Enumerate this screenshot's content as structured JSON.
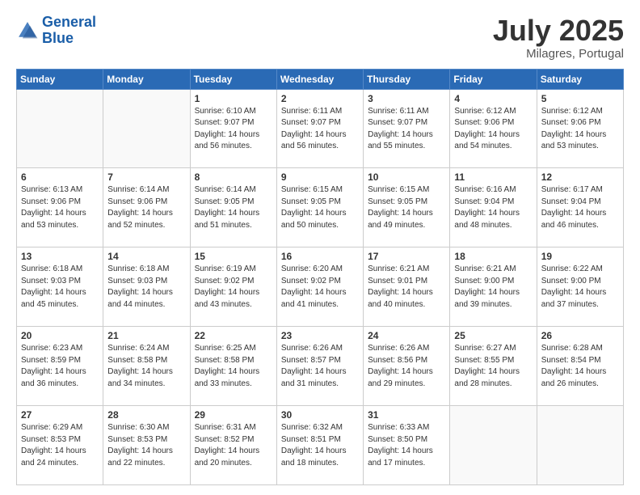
{
  "logo": {
    "line1": "General",
    "line2": "Blue"
  },
  "header": {
    "month": "July 2025",
    "location": "Milagres, Portugal"
  },
  "weekdays": [
    "Sunday",
    "Monday",
    "Tuesday",
    "Wednesday",
    "Thursday",
    "Friday",
    "Saturday"
  ],
  "weeks": [
    [
      {
        "day": "",
        "sunrise": "",
        "sunset": "",
        "daylight": ""
      },
      {
        "day": "",
        "sunrise": "",
        "sunset": "",
        "daylight": ""
      },
      {
        "day": "1",
        "sunrise": "Sunrise: 6:10 AM",
        "sunset": "Sunset: 9:07 PM",
        "daylight": "Daylight: 14 hours and 56 minutes."
      },
      {
        "day": "2",
        "sunrise": "Sunrise: 6:11 AM",
        "sunset": "Sunset: 9:07 PM",
        "daylight": "Daylight: 14 hours and 56 minutes."
      },
      {
        "day": "3",
        "sunrise": "Sunrise: 6:11 AM",
        "sunset": "Sunset: 9:07 PM",
        "daylight": "Daylight: 14 hours and 55 minutes."
      },
      {
        "day": "4",
        "sunrise": "Sunrise: 6:12 AM",
        "sunset": "Sunset: 9:06 PM",
        "daylight": "Daylight: 14 hours and 54 minutes."
      },
      {
        "day": "5",
        "sunrise": "Sunrise: 6:12 AM",
        "sunset": "Sunset: 9:06 PM",
        "daylight": "Daylight: 14 hours and 53 minutes."
      }
    ],
    [
      {
        "day": "6",
        "sunrise": "Sunrise: 6:13 AM",
        "sunset": "Sunset: 9:06 PM",
        "daylight": "Daylight: 14 hours and 53 minutes."
      },
      {
        "day": "7",
        "sunrise": "Sunrise: 6:14 AM",
        "sunset": "Sunset: 9:06 PM",
        "daylight": "Daylight: 14 hours and 52 minutes."
      },
      {
        "day": "8",
        "sunrise": "Sunrise: 6:14 AM",
        "sunset": "Sunset: 9:05 PM",
        "daylight": "Daylight: 14 hours and 51 minutes."
      },
      {
        "day": "9",
        "sunrise": "Sunrise: 6:15 AM",
        "sunset": "Sunset: 9:05 PM",
        "daylight": "Daylight: 14 hours and 50 minutes."
      },
      {
        "day": "10",
        "sunrise": "Sunrise: 6:15 AM",
        "sunset": "Sunset: 9:05 PM",
        "daylight": "Daylight: 14 hours and 49 minutes."
      },
      {
        "day": "11",
        "sunrise": "Sunrise: 6:16 AM",
        "sunset": "Sunset: 9:04 PM",
        "daylight": "Daylight: 14 hours and 48 minutes."
      },
      {
        "day": "12",
        "sunrise": "Sunrise: 6:17 AM",
        "sunset": "Sunset: 9:04 PM",
        "daylight": "Daylight: 14 hours and 46 minutes."
      }
    ],
    [
      {
        "day": "13",
        "sunrise": "Sunrise: 6:18 AM",
        "sunset": "Sunset: 9:03 PM",
        "daylight": "Daylight: 14 hours and 45 minutes."
      },
      {
        "day": "14",
        "sunrise": "Sunrise: 6:18 AM",
        "sunset": "Sunset: 9:03 PM",
        "daylight": "Daylight: 14 hours and 44 minutes."
      },
      {
        "day": "15",
        "sunrise": "Sunrise: 6:19 AM",
        "sunset": "Sunset: 9:02 PM",
        "daylight": "Daylight: 14 hours and 43 minutes."
      },
      {
        "day": "16",
        "sunrise": "Sunrise: 6:20 AM",
        "sunset": "Sunset: 9:02 PM",
        "daylight": "Daylight: 14 hours and 41 minutes."
      },
      {
        "day": "17",
        "sunrise": "Sunrise: 6:21 AM",
        "sunset": "Sunset: 9:01 PM",
        "daylight": "Daylight: 14 hours and 40 minutes."
      },
      {
        "day": "18",
        "sunrise": "Sunrise: 6:21 AM",
        "sunset": "Sunset: 9:00 PM",
        "daylight": "Daylight: 14 hours and 39 minutes."
      },
      {
        "day": "19",
        "sunrise": "Sunrise: 6:22 AM",
        "sunset": "Sunset: 9:00 PM",
        "daylight": "Daylight: 14 hours and 37 minutes."
      }
    ],
    [
      {
        "day": "20",
        "sunrise": "Sunrise: 6:23 AM",
        "sunset": "Sunset: 8:59 PM",
        "daylight": "Daylight: 14 hours and 36 minutes."
      },
      {
        "day": "21",
        "sunrise": "Sunrise: 6:24 AM",
        "sunset": "Sunset: 8:58 PM",
        "daylight": "Daylight: 14 hours and 34 minutes."
      },
      {
        "day": "22",
        "sunrise": "Sunrise: 6:25 AM",
        "sunset": "Sunset: 8:58 PM",
        "daylight": "Daylight: 14 hours and 33 minutes."
      },
      {
        "day": "23",
        "sunrise": "Sunrise: 6:26 AM",
        "sunset": "Sunset: 8:57 PM",
        "daylight": "Daylight: 14 hours and 31 minutes."
      },
      {
        "day": "24",
        "sunrise": "Sunrise: 6:26 AM",
        "sunset": "Sunset: 8:56 PM",
        "daylight": "Daylight: 14 hours and 29 minutes."
      },
      {
        "day": "25",
        "sunrise": "Sunrise: 6:27 AM",
        "sunset": "Sunset: 8:55 PM",
        "daylight": "Daylight: 14 hours and 28 minutes."
      },
      {
        "day": "26",
        "sunrise": "Sunrise: 6:28 AM",
        "sunset": "Sunset: 8:54 PM",
        "daylight": "Daylight: 14 hours and 26 minutes."
      }
    ],
    [
      {
        "day": "27",
        "sunrise": "Sunrise: 6:29 AM",
        "sunset": "Sunset: 8:53 PM",
        "daylight": "Daylight: 14 hours and 24 minutes."
      },
      {
        "day": "28",
        "sunrise": "Sunrise: 6:30 AM",
        "sunset": "Sunset: 8:53 PM",
        "daylight": "Daylight: 14 hours and 22 minutes."
      },
      {
        "day": "29",
        "sunrise": "Sunrise: 6:31 AM",
        "sunset": "Sunset: 8:52 PM",
        "daylight": "Daylight: 14 hours and 20 minutes."
      },
      {
        "day": "30",
        "sunrise": "Sunrise: 6:32 AM",
        "sunset": "Sunset: 8:51 PM",
        "daylight": "Daylight: 14 hours and 18 minutes."
      },
      {
        "day": "31",
        "sunrise": "Sunrise: 6:33 AM",
        "sunset": "Sunset: 8:50 PM",
        "daylight": "Daylight: 14 hours and 17 minutes."
      },
      {
        "day": "",
        "sunrise": "",
        "sunset": "",
        "daylight": ""
      },
      {
        "day": "",
        "sunrise": "",
        "sunset": "",
        "daylight": ""
      }
    ]
  ]
}
